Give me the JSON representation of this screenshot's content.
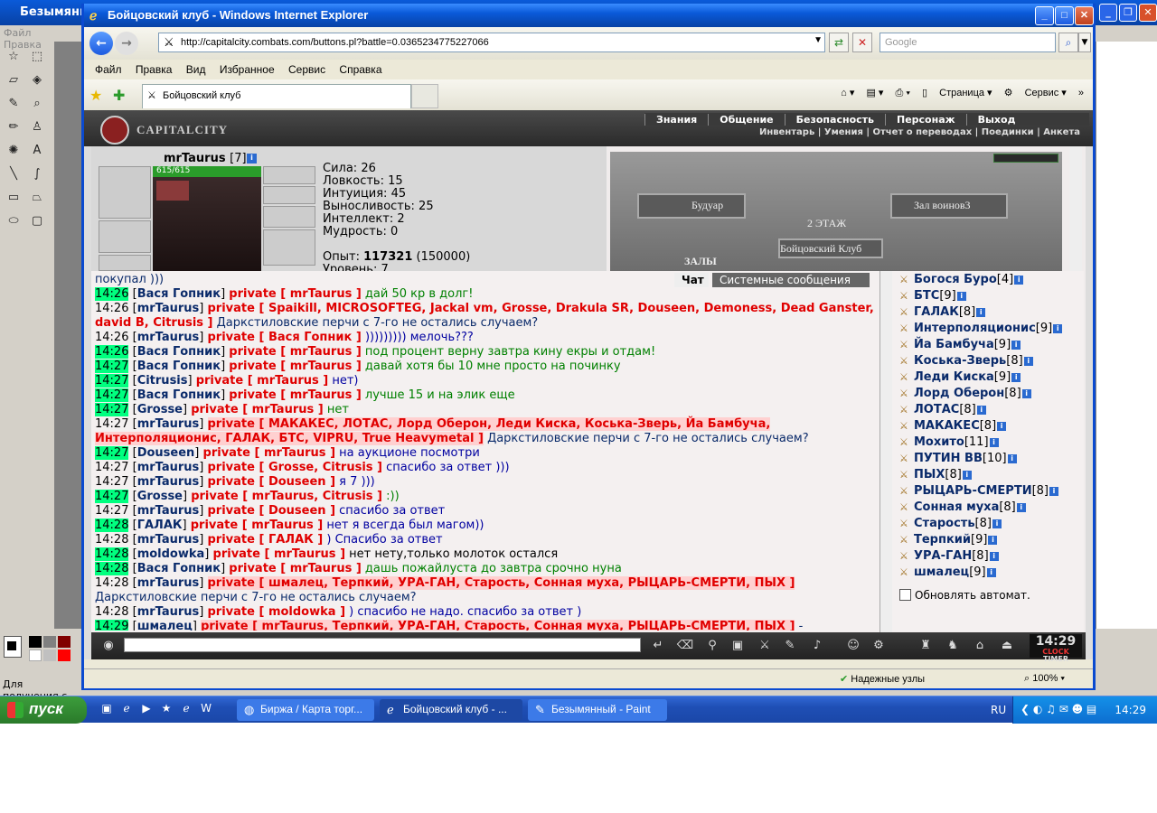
{
  "paint": {
    "title": "Безымянн",
    "menu": [
      "Файл",
      "Правка"
    ],
    "status": "Для получения с"
  },
  "ie": {
    "title": "Бойцовский клуб - Windows Internet Explorer",
    "url": "http://capitalcity.combats.com/buttons.pl?battle=0.0365234775227066",
    "search_placeholder": "Google",
    "menu": [
      "Файл",
      "Правка",
      "Вид",
      "Избранное",
      "Сервис",
      "Справка"
    ],
    "tab_label": "Бойцовский клуб",
    "tools": {
      "page": "Страница",
      "service": "Сервис"
    },
    "status": {
      "security": "Надежные узлы",
      "zoom": "100%"
    }
  },
  "game": {
    "logo": "CAPITALCITY",
    "nav": [
      "Знания",
      "Общение",
      "Безопасность",
      "Персонаж",
      "Выход"
    ],
    "subnav": "Инвентарь | Умения | Отчет о переводах | Поединки | Анкета",
    "character": {
      "name": "mrTaurus",
      "level": "[7]",
      "hp": "615/615",
      "stats": [
        "Сила: 26",
        "Ловкость: 15",
        "Интуиция: 45",
        "Выносливость: 25",
        "Интеллект: 2",
        "Мудрость: 0"
      ],
      "exp_label": "Опыт:",
      "exp_value": "117321",
      "exp_next": "(150000)",
      "level_label": "Уровень: 7"
    },
    "map": {
      "left": "Будуар",
      "right": "Зал воинов3",
      "floor": "2 ЭТАЖ",
      "halls": "ЗАЛЫ",
      "club": "Бойцовский Клуб"
    },
    "chat_tabs": {
      "chat": "Чат",
      "system": "Системные сообщения"
    },
    "chat_first": "покупал )))",
    "chat": [
      {
        "t": "14:26",
        "hl": true,
        "nm": "Вася Гопник",
        "pv": "private [ mrTaurus ]",
        "msg": "дай 50 кр в долг!",
        "c": "m2"
      },
      {
        "t": "14:26",
        "hl": false,
        "nm": "mrTaurus",
        "pv": "private [ Spaikill, MICROSOFTEG, Jackal vm, Grosse, Drakula SR, Douseen, Demoness, Dead Ganster,",
        "msg": "",
        "c": "m1"
      },
      {
        "t": "",
        "hl": false,
        "nm": "",
        "pv": "david B, Citrusis ]",
        "msg": "Даркстиловские перчи с 7-го не остались случаем?",
        "c": "m1"
      },
      {
        "t": "14:26",
        "hl": false,
        "nm": "mrTaurus",
        "pv": "private [ Вася Гопник ]",
        "msg": "))))))))) мелочь???",
        "c": "m3"
      },
      {
        "t": "14:26",
        "hl": true,
        "nm": "Вася Гопник",
        "pv": "private [ mrTaurus ]",
        "msg": "под процент верну завтра кину екры и отдам!",
        "c": "m2"
      },
      {
        "t": "14:27",
        "hl": true,
        "nm": "Вася Гопник",
        "pv": "private [ mrTaurus ]",
        "msg": "давай хотя бы 10 мне просто на починку",
        "c": "m2"
      },
      {
        "t": "14:27",
        "hl": true,
        "nm": "Citrusis",
        "pv": "private [ mrTaurus ]",
        "msg": "нет)",
        "c": "m3"
      },
      {
        "t": "14:27",
        "hl": true,
        "nm": "Вася Гопник",
        "pv": "private [ mrTaurus ]",
        "msg": "лучше 15 и на элик еще",
        "c": "m2"
      },
      {
        "t": "14:27",
        "hl": true,
        "nm": "Grosse",
        "pv": "private [ mrTaurus ]",
        "msg": "нет",
        "c": "m2"
      },
      {
        "t": "14:27",
        "hl": false,
        "nm": "mrTaurus",
        "pv": "private [ МАКАКЕС, ЛОТАС, Лорд Оберон, Леди Киска, Коська-Зверь, Йа Бамбуча,",
        "msg": "",
        "c": "m1",
        "pvbg": true
      },
      {
        "t": "",
        "hl": false,
        "nm": "",
        "pv": "Интерполяционис, ГАЛАК, БТС, VIPRU, True Heavymetal ]",
        "msg": "Даркстиловские перчи с 7-го не остались случаем?",
        "c": "m1",
        "pvbg": true
      },
      {
        "t": "14:27",
        "hl": true,
        "nm": "Douseen",
        "pv": "private [ mrTaurus ]",
        "msg": "на аукционе посмотри",
        "c": "m3"
      },
      {
        "t": "14:27",
        "hl": false,
        "nm": "mrTaurus",
        "pv": "private [ Grosse, Citrusis ]",
        "msg": "спасибо за ответ )))",
        "c": "m3"
      },
      {
        "t": "14:27",
        "hl": false,
        "nm": "mrTaurus",
        "pv": "private [ Douseen ]",
        "msg": "я 7 )))",
        "c": "m3"
      },
      {
        "t": "14:27",
        "hl": true,
        "nm": "Grosse",
        "pv": "private [ mrTaurus, Citrusis ]",
        "msg": ":))",
        "c": "m2"
      },
      {
        "t": "14:27",
        "hl": false,
        "nm": "mrTaurus",
        "pv": "private [ Douseen ]",
        "msg": "спасибо за ответ",
        "c": "m3"
      },
      {
        "t": "14:28",
        "hl": true,
        "nm": "ГАЛАК",
        "pv": "private [ mrTaurus ]",
        "msg": "нет я всегда был магом))",
        "c": "m3"
      },
      {
        "t": "14:28",
        "hl": false,
        "nm": "mrTaurus",
        "pv": "private [ ГАЛАК ]",
        "msg": ") Спасибо за ответ",
        "c": "m3"
      },
      {
        "t": "14:28",
        "hl": true,
        "nm": "moldowka",
        "pv": "private [ mrTaurus ]",
        "msg": "нет нету,только молоток остался",
        "c": "t"
      },
      {
        "t": "14:28",
        "hl": true,
        "nm": "Вася Гопник",
        "pv": "private [ mrTaurus ]",
        "msg": "дашь пожайлуста до завтра срочно нуна",
        "c": "m2"
      },
      {
        "t": "14:28",
        "hl": false,
        "nm": "mrTaurus",
        "pv": "private [ шмалец, Терпкий, УРА-ГАН, Старость, Сонная муха, РЫЦАРЬ-СМЕРТИ, ПЫХ ]",
        "msg": "",
        "c": "m1",
        "pvbg": true
      },
      {
        "t": "",
        "hl": false,
        "nm": "",
        "pv": "",
        "msg": "Даркстиловские перчи с 7-го не остались случаем?",
        "c": "m1"
      },
      {
        "t": "14:28",
        "hl": false,
        "nm": "mrTaurus",
        "pv": "private [ moldowka ]",
        "msg": ") спасибо не надо. спасибо за ответ )",
        "c": "m3"
      },
      {
        "t": "14:29",
        "hl": true,
        "nm": "шмалец",
        "pv": "private [ mrTaurus, Терпкий, УРА-ГАН, Старость, Сонная муха, РЫЦАРЬ-СМЕРТИ, ПЫХ ]",
        "msg": "-",
        "c": "m1",
        "pvbg": true
      }
    ],
    "users": [
      {
        "n": "Богося Буро",
        "lv": "[4]"
      },
      {
        "n": "БТС",
        "lv": "[9]"
      },
      {
        "n": "ГАЛАК",
        "lv": "[8]"
      },
      {
        "n": "Интерполяционис",
        "lv": "[9]"
      },
      {
        "n": "Йа Бамбуча",
        "lv": "[9]"
      },
      {
        "n": "Коська-Зверь",
        "lv": "[8]"
      },
      {
        "n": "Леди Киска",
        "lv": "[9]"
      },
      {
        "n": "Лорд Оберон",
        "lv": "[8]"
      },
      {
        "n": "ЛОТАС",
        "lv": "[8]"
      },
      {
        "n": "МАКАКЕС",
        "lv": "[8]"
      },
      {
        "n": "Мохито",
        "lv": "[11]"
      },
      {
        "n": "ПУТИН ВВ",
        "lv": "[10]"
      },
      {
        "n": "ПЫХ",
        "lv": "[8]"
      },
      {
        "n": "РЫЦАРЬ-СМЕРТИ",
        "lv": "[8]"
      },
      {
        "n": "Сонная муха",
        "lv": "[8]"
      },
      {
        "n": "Старость",
        "lv": "[8]"
      },
      {
        "n": "Терпкий",
        "lv": "[9]"
      },
      {
        "n": "УРА-ГАН",
        "lv": "[8]"
      },
      {
        "n": "шмалец",
        "lv": "[9]"
      }
    ],
    "autorefresh": "Обновлять автомат.",
    "clock": "14:29",
    "clock_label1": "CLOCK",
    "clock_label2": "TIMER"
  },
  "taskbar": {
    "start": "пуск",
    "items": [
      "Биржа / Карта торг...",
      "Бойцовский клуб - ...",
      "Безымянный - Paint"
    ],
    "lang": "RU",
    "time": "14:29"
  }
}
